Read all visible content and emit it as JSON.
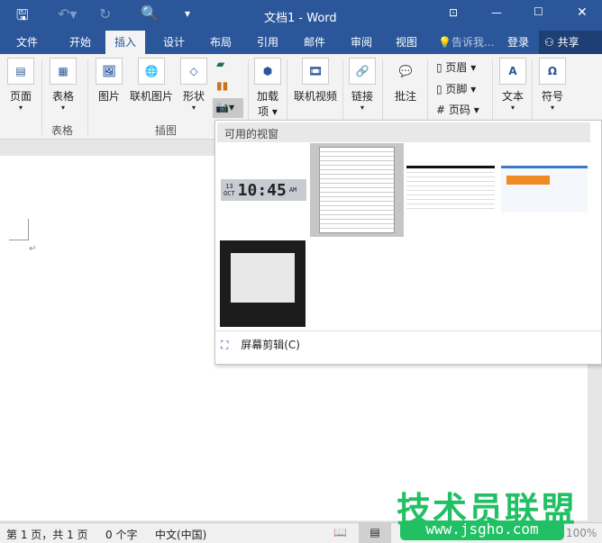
{
  "title": "文档1 - Word",
  "tabs": [
    "文件",
    "开始",
    "插入",
    "设计",
    "布局",
    "引用",
    "邮件",
    "审阅",
    "视图"
  ],
  "tell_me": "告诉我...",
  "login": "登录",
  "share": "共享",
  "ribbon": {
    "page": "页面",
    "table": "表格",
    "picture": "图片",
    "online_picture": "联机图片",
    "shapes": "形状",
    "addins_1": "加载",
    "addins_2": "项",
    "online_video": "联机视频",
    "link": "链接",
    "comment": "批注",
    "header": "页眉",
    "footer": "页脚",
    "page_number": "页码",
    "text": "文本",
    "symbol": "符号",
    "group_table": "表格",
    "group_illustrations": "插图"
  },
  "dropdown": {
    "title": "可用的视窗",
    "clock_date": "13",
    "clock_month": "OCT",
    "clock_time": "10:45",
    "clock_ampm": "AM",
    "screen_clipping": "屏幕剪辑(C)"
  },
  "status": {
    "page": "第 1 页，共 1 页",
    "words": "0 个字",
    "language": "中文(中国)",
    "zoom": "100%"
  },
  "watermark": {
    "name": "技术员联盟",
    "url": "www.jsgho.com"
  }
}
